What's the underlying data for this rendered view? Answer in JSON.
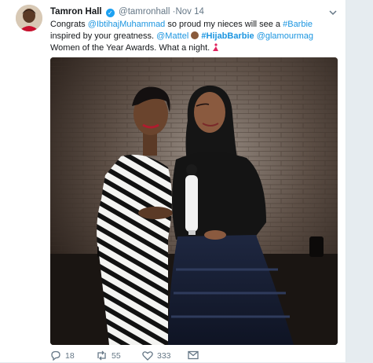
{
  "tweet": {
    "author_name": "Tamron Hall",
    "handle": "@tamronhall",
    "separator": "·",
    "date": "Nov 14",
    "verified": true,
    "text": {
      "t1": "Congrats ",
      "mention1": "@IbtihajMuhammad",
      "t2": " so proud my nieces will see a ",
      "hashtag1": "#Barbie",
      "t3": " inspired by your greatness. ",
      "mention2": "@Mattel",
      "t4": " ",
      "hashtag2": "#HijabBarbie",
      "t5": " ",
      "mention3": "@glamourmag",
      "t6": " Women of the Year Awards. What a night. "
    },
    "emojis": [
      "raised-fist-emoji",
      "dancer-emoji"
    ]
  },
  "actions": {
    "reply_count": "18",
    "retweet_count": "55",
    "like_count": "333"
  },
  "colors": {
    "link": "#1b95e0",
    "verified_badge": "#1da1f2",
    "muted_text": "#657786",
    "background": "#e6ecf0"
  }
}
